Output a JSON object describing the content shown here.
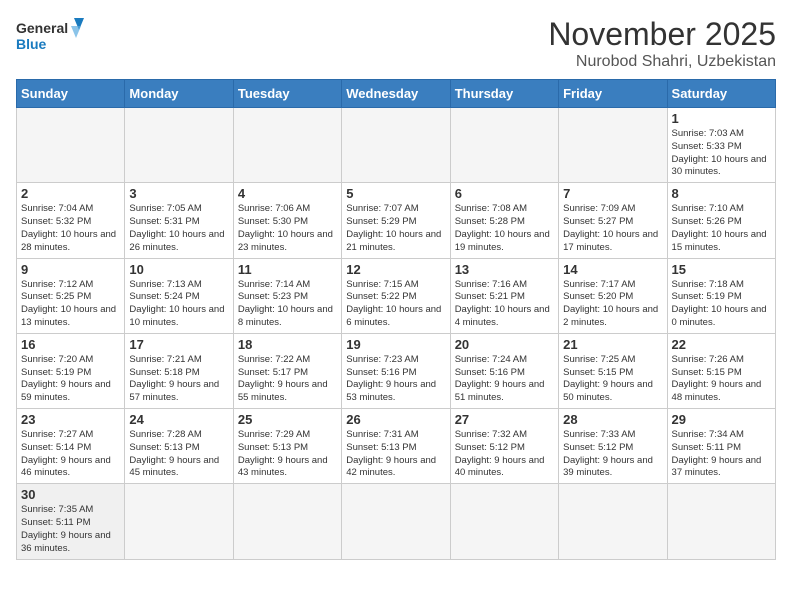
{
  "header": {
    "logo_general": "General",
    "logo_blue": "Blue",
    "month_title": "November 2025",
    "location": "Nurobod Shahri, Uzbekistan"
  },
  "weekdays": [
    "Sunday",
    "Monday",
    "Tuesday",
    "Wednesday",
    "Thursday",
    "Friday",
    "Saturday"
  ],
  "days": [
    {
      "num": "",
      "info": ""
    },
    {
      "num": "",
      "info": ""
    },
    {
      "num": "",
      "info": ""
    },
    {
      "num": "",
      "info": ""
    },
    {
      "num": "",
      "info": ""
    },
    {
      "num": "",
      "info": ""
    },
    {
      "num": "1",
      "info": "Sunrise: 7:03 AM\nSunset: 5:33 PM\nDaylight: 10 hours and 30 minutes."
    },
    {
      "num": "2",
      "info": "Sunrise: 7:04 AM\nSunset: 5:32 PM\nDaylight: 10 hours and 28 minutes."
    },
    {
      "num": "3",
      "info": "Sunrise: 7:05 AM\nSunset: 5:31 PM\nDaylight: 10 hours and 26 minutes."
    },
    {
      "num": "4",
      "info": "Sunrise: 7:06 AM\nSunset: 5:30 PM\nDaylight: 10 hours and 23 minutes."
    },
    {
      "num": "5",
      "info": "Sunrise: 7:07 AM\nSunset: 5:29 PM\nDaylight: 10 hours and 21 minutes."
    },
    {
      "num": "6",
      "info": "Sunrise: 7:08 AM\nSunset: 5:28 PM\nDaylight: 10 hours and 19 minutes."
    },
    {
      "num": "7",
      "info": "Sunrise: 7:09 AM\nSunset: 5:27 PM\nDaylight: 10 hours and 17 minutes."
    },
    {
      "num": "8",
      "info": "Sunrise: 7:10 AM\nSunset: 5:26 PM\nDaylight: 10 hours and 15 minutes."
    },
    {
      "num": "9",
      "info": "Sunrise: 7:12 AM\nSunset: 5:25 PM\nDaylight: 10 hours and 13 minutes."
    },
    {
      "num": "10",
      "info": "Sunrise: 7:13 AM\nSunset: 5:24 PM\nDaylight: 10 hours and 10 minutes."
    },
    {
      "num": "11",
      "info": "Sunrise: 7:14 AM\nSunset: 5:23 PM\nDaylight: 10 hours and 8 minutes."
    },
    {
      "num": "12",
      "info": "Sunrise: 7:15 AM\nSunset: 5:22 PM\nDaylight: 10 hours and 6 minutes."
    },
    {
      "num": "13",
      "info": "Sunrise: 7:16 AM\nSunset: 5:21 PM\nDaylight: 10 hours and 4 minutes."
    },
    {
      "num": "14",
      "info": "Sunrise: 7:17 AM\nSunset: 5:20 PM\nDaylight: 10 hours and 2 minutes."
    },
    {
      "num": "15",
      "info": "Sunrise: 7:18 AM\nSunset: 5:19 PM\nDaylight: 10 hours and 0 minutes."
    },
    {
      "num": "16",
      "info": "Sunrise: 7:20 AM\nSunset: 5:19 PM\nDaylight: 9 hours and 59 minutes."
    },
    {
      "num": "17",
      "info": "Sunrise: 7:21 AM\nSunset: 5:18 PM\nDaylight: 9 hours and 57 minutes."
    },
    {
      "num": "18",
      "info": "Sunrise: 7:22 AM\nSunset: 5:17 PM\nDaylight: 9 hours and 55 minutes."
    },
    {
      "num": "19",
      "info": "Sunrise: 7:23 AM\nSunset: 5:16 PM\nDaylight: 9 hours and 53 minutes."
    },
    {
      "num": "20",
      "info": "Sunrise: 7:24 AM\nSunset: 5:16 PM\nDaylight: 9 hours and 51 minutes."
    },
    {
      "num": "21",
      "info": "Sunrise: 7:25 AM\nSunset: 5:15 PM\nDaylight: 9 hours and 50 minutes."
    },
    {
      "num": "22",
      "info": "Sunrise: 7:26 AM\nSunset: 5:15 PM\nDaylight: 9 hours and 48 minutes."
    },
    {
      "num": "23",
      "info": "Sunrise: 7:27 AM\nSunset: 5:14 PM\nDaylight: 9 hours and 46 minutes."
    },
    {
      "num": "24",
      "info": "Sunrise: 7:28 AM\nSunset: 5:13 PM\nDaylight: 9 hours and 45 minutes."
    },
    {
      "num": "25",
      "info": "Sunrise: 7:29 AM\nSunset: 5:13 PM\nDaylight: 9 hours and 43 minutes."
    },
    {
      "num": "26",
      "info": "Sunrise: 7:31 AM\nSunset: 5:13 PM\nDaylight: 9 hours and 42 minutes."
    },
    {
      "num": "27",
      "info": "Sunrise: 7:32 AM\nSunset: 5:12 PM\nDaylight: 9 hours and 40 minutes."
    },
    {
      "num": "28",
      "info": "Sunrise: 7:33 AM\nSunset: 5:12 PM\nDaylight: 9 hours and 39 minutes."
    },
    {
      "num": "29",
      "info": "Sunrise: 7:34 AM\nSunset: 5:11 PM\nDaylight: 9 hours and 37 minutes."
    },
    {
      "num": "30",
      "info": "Sunrise: 7:35 AM\nSunset: 5:11 PM\nDaylight: 9 hours and 36 minutes."
    },
    {
      "num": "",
      "info": ""
    },
    {
      "num": "",
      "info": ""
    },
    {
      "num": "",
      "info": ""
    },
    {
      "num": "",
      "info": ""
    },
    {
      "num": "",
      "info": ""
    },
    {
      "num": "",
      "info": ""
    }
  ]
}
